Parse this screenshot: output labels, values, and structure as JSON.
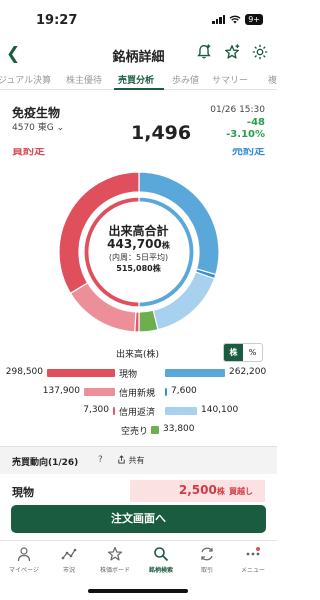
{
  "status": {
    "time": "19:27",
    "battery": "9+"
  },
  "nav": {
    "title": "銘柄詳細"
  },
  "tabs": [
    "ジュアル決算",
    "株主優待",
    "売買分析",
    "歩み値",
    "サマリー",
    "複"
  ],
  "stock": {
    "name": "免疫生物",
    "code": "4570",
    "market": "東G",
    "price": "1,496",
    "time": "01/26 15:30",
    "change": "-48",
    "change_pct": "-3.10%"
  },
  "donut": {
    "buy_label": "買約定",
    "sell_label": "売約定",
    "center_title": "出来高合計",
    "center_total": "443,700",
    "center_total_unit": "株",
    "center_sub": "(内周：5日平均)",
    "center_sub_value": "515,080",
    "center_sub_unit": "株"
  },
  "volume": {
    "label": "出来高(株)",
    "unit_options": [
      "株",
      "%"
    ],
    "selected_unit": "株"
  },
  "chart_data": {
    "type": "bar",
    "categories": [
      "現物",
      "信用新規",
      "信用返済",
      "空売り"
    ],
    "series": [
      {
        "name": "買約定",
        "values": [
          298500,
          137900,
          7300,
          null
        ],
        "colors": [
          "#e0505c",
          "#ec8f98",
          "#e35a66",
          null
        ]
      },
      {
        "name": "売約定",
        "values": [
          262200,
          7600,
          140100,
          33800
        ],
        "colors": [
          "#5aa7da",
          "#3a8fcf",
          "#a7d1ef",
          "#6dae4f"
        ]
      }
    ],
    "display": {
      "buy": [
        "298,500",
        "137,900",
        "7,300",
        ""
      ],
      "sell": [
        "262,200",
        "7,600",
        "140,100",
        "33,800"
      ]
    },
    "max": 298500
  },
  "trend": {
    "title": "売買動向(1/26)",
    "help": "?",
    "share": "共有"
  },
  "genbutsu": {
    "label": "現物",
    "value": "2,500",
    "unit": "株",
    "tag": "買越し"
  },
  "order_button": "注文画面へ",
  "bottom_nav": [
    {
      "icon": "person-icon",
      "label": "マイページ"
    },
    {
      "icon": "market-icon",
      "label": "市況"
    },
    {
      "icon": "star-icon",
      "label": "株価ボード"
    },
    {
      "icon": "search-icon",
      "label": "銘柄検索"
    },
    {
      "icon": "trade-icon",
      "label": "取引"
    },
    {
      "icon": "menu-icon",
      "label": "メニュー"
    }
  ],
  "colors": {
    "brand": "#1a5c40",
    "buy": "#e0505c",
    "sell": "#5aa7da",
    "down": "#2a9d4f"
  }
}
